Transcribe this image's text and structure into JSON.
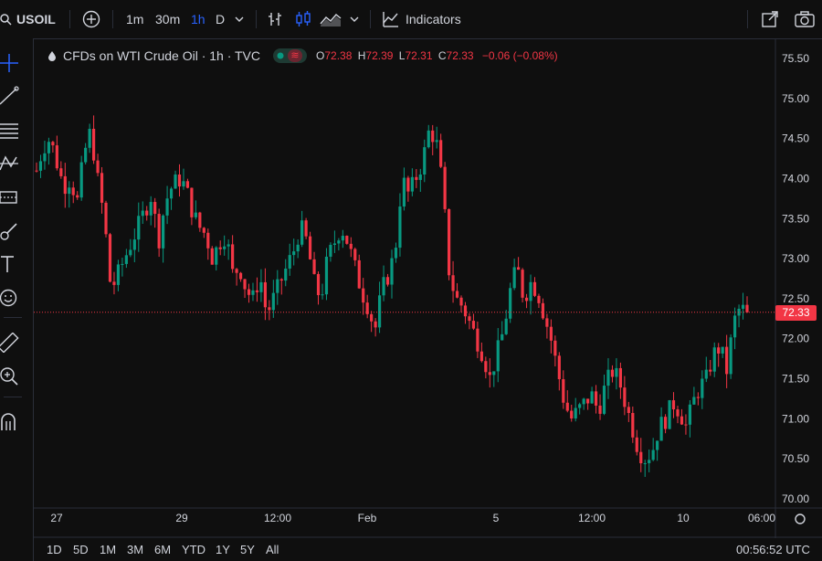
{
  "toolbar": {
    "symbol": "USOIL",
    "intervals": [
      "1m",
      "30m",
      "1h",
      "D"
    ],
    "active_interval": "1h",
    "indicators_label": "Indicators"
  },
  "legend": {
    "title": "CFDs on WTI Crude Oil · 1h · TVC",
    "o_label": "O",
    "o": "72.38",
    "h_label": "H",
    "h": "72.39",
    "l_label": "L",
    "l": "72.31",
    "c_label": "C",
    "c": "72.33",
    "change": "−0.06 (−0.08%)"
  },
  "price_scale": {
    "ticks": [
      "75.50",
      "75.00",
      "74.50",
      "74.00",
      "73.50",
      "73.00",
      "72.50",
      "72.00",
      "71.50",
      "71.00",
      "70.50",
      "70.00"
    ],
    "last_price": "72.33"
  },
  "time_scale": {
    "ticks": [
      "27",
      "29",
      "12:00",
      "Feb",
      "5",
      "12:00",
      "10",
      "06:00"
    ]
  },
  "bottom": {
    "ranges": [
      "1D",
      "5D",
      "1M",
      "3M",
      "6M",
      "YTD",
      "1Y",
      "5Y",
      "All"
    ],
    "clock": "00:56:52 UTC"
  },
  "colors": {
    "up": "#089981",
    "down": "#f23645",
    "accent": "#2962ff",
    "bg": "#0f0f0f",
    "grid": "#1e222d"
  },
  "chart_data": {
    "type": "candlestick",
    "ylim": [
      70.0,
      75.5
    ],
    "close_path": [
      74.1,
      74.4,
      74.5,
      74.2,
      73.9,
      74.0,
      73.7,
      74.3,
      74.6,
      74.0,
      73.5,
      72.6,
      72.8,
      73.0,
      73.2,
      73.4,
      73.6,
      73.8,
      73.2,
      73.7,
      73.9,
      74.0,
      73.9,
      73.6,
      73.4,
      73.3,
      73.0,
      73.2,
      73.3,
      72.8,
      72.9,
      72.6,
      72.5,
      72.8,
      72.3,
      72.5,
      72.7,
      72.9,
      73.1,
      73.4,
      73.2,
      72.7,
      72.5,
      73.0,
      73.2,
      73.4,
      73.2,
      72.9,
      72.6,
      72.4,
      72.1,
      72.6,
      72.8,
      73.1,
      74.0,
      73.8,
      74.0,
      74.2,
      74.6,
      74.5,
      73.9,
      72.8,
      72.5,
      72.4,
      72.2,
      72.0,
      71.8,
      71.5,
      71.8,
      72.1,
      72.6,
      72.9,
      72.5,
      72.7,
      72.6,
      72.3,
      72.0,
      71.6,
      71.2,
      71.0,
      71.1,
      71.2,
      71.3,
      71.1,
      71.4,
      71.6,
      71.5,
      71.2,
      70.9,
      70.6,
      70.5,
      70.6,
      70.9,
      71.0,
      71.2,
      71.1,
      70.9,
      71.2,
      71.4,
      71.5,
      71.8,
      71.9,
      71.6,
      72.2,
      72.4,
      72.3
    ],
    "last": 72.33
  }
}
